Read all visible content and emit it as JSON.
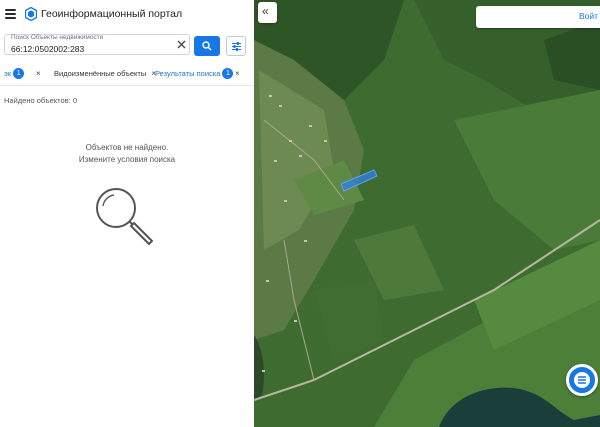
{
  "header": {
    "title": "Геоинформационный портал",
    "menu_icon": "menu-icon",
    "logo_icon": "portal-logo-icon"
  },
  "search": {
    "label": "Поиск Объекты недвижимости",
    "value": "66:12:0502002:283",
    "clear_icon": "close-icon",
    "button_icon": "search-icon",
    "filter_icon": "filter-sliders-icon"
  },
  "tabs": {
    "prev_tab_fragment": "эк",
    "prev_tab_count": "1",
    "active_label": "Видоизменённые объекты",
    "results_label": "Результаты поиска",
    "results_count": "1",
    "close_glyph": "×"
  },
  "results": {
    "found_text": "Найдено объектов: 0",
    "empty_line_1": "Объектов не найдено.",
    "empty_line_2": "Измените условия поиска",
    "empty_icon": "magnifier-icon"
  },
  "map": {
    "collapse_label": "«",
    "login_label": "Войт",
    "fab_icon": "layers-list-icon",
    "highlight_color": "#2f7fe0"
  },
  "colors": {
    "accent": "#1677e6",
    "map_green": "#3d6a2f"
  }
}
